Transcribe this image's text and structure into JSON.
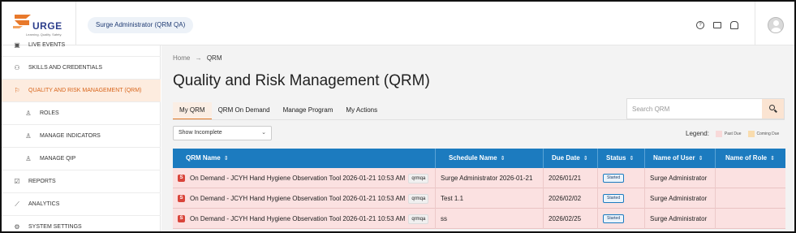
{
  "header": {
    "logo_text": "URGE",
    "logo_tagline": "Learning. Quality. Safety.",
    "tenant_label": "Surge Administrator (QRM QA)",
    "icons": [
      "help-icon",
      "mail-icon",
      "bell-icon"
    ]
  },
  "sidebar": {
    "items": [
      {
        "label": "LIVE EVENTS",
        "icon": "calendar-icon"
      },
      {
        "label": "SKILLS AND CREDENTIALS",
        "icon": "users-icon"
      },
      {
        "label": "QUALITY AND RISK MANAGEMENT (QRM)",
        "icon": "flag-icon"
      },
      {
        "label": "ROLES",
        "icon": "person-icon"
      },
      {
        "label": "MANAGE INDICATORS",
        "icon": "person-icon"
      },
      {
        "label": "MANAGE QIP",
        "icon": "person-icon"
      },
      {
        "label": "REPORTS",
        "icon": "report-icon"
      },
      {
        "label": "ANALYTICS",
        "icon": "analytics-icon"
      },
      {
        "label": "SYSTEM SETTINGS",
        "icon": "gear-icon"
      }
    ]
  },
  "breadcrumb": {
    "home": "Home",
    "sep": "→",
    "current": "QRM"
  },
  "page_title": "Quality and Risk Management (QRM)",
  "tabs": [
    "My QRM",
    "QRM On Demand",
    "Manage Program",
    "My Actions"
  ],
  "search": {
    "placeholder": "Search QRM"
  },
  "filter": {
    "selected": "Show Incomplete"
  },
  "legend": {
    "title": "Legend:",
    "past_due": "Past Due",
    "coming_due": "Coming Due",
    "past_due_color": "#f8d9d9",
    "coming_due_color": "#f9dcae"
  },
  "table": {
    "columns": [
      "QRM Name",
      "Schedule Name",
      "Due Date",
      "Status",
      "Name of User",
      "Name of Role"
    ],
    "rows": [
      {
        "badge": "S",
        "name": "On Demand - JCYH Hand Hygiene Observation Tool 2026-01-21 10:53 AM",
        "tag": "qrmqa",
        "schedule": "Surge Administrator 2026-01-21",
        "due": "2026/01/21",
        "status": "Started",
        "user": "Surge Administrator",
        "role": ""
      },
      {
        "badge": "S",
        "name": "On Demand - JCYH Hand Hygiene Observation Tool 2026-01-21 10:53 AM",
        "tag": "qrmqa",
        "schedule": "Test 1.1",
        "due": "2026/02/02",
        "status": "Started",
        "user": "Surge Administrator",
        "role": ""
      },
      {
        "badge": "S",
        "name": "On Demand - JCYH Hand Hygiene Observation Tool 2026-01-21 10:53 AM",
        "tag": "qrmqa",
        "schedule": "ss",
        "due": "2026/02/25",
        "status": "Started",
        "user": "Surge Administrator",
        "role": ""
      }
    ]
  },
  "colors": {
    "accent": "#e07a2a",
    "table_header": "#1c7bbf",
    "row_past_due": "#fbe1e1"
  }
}
